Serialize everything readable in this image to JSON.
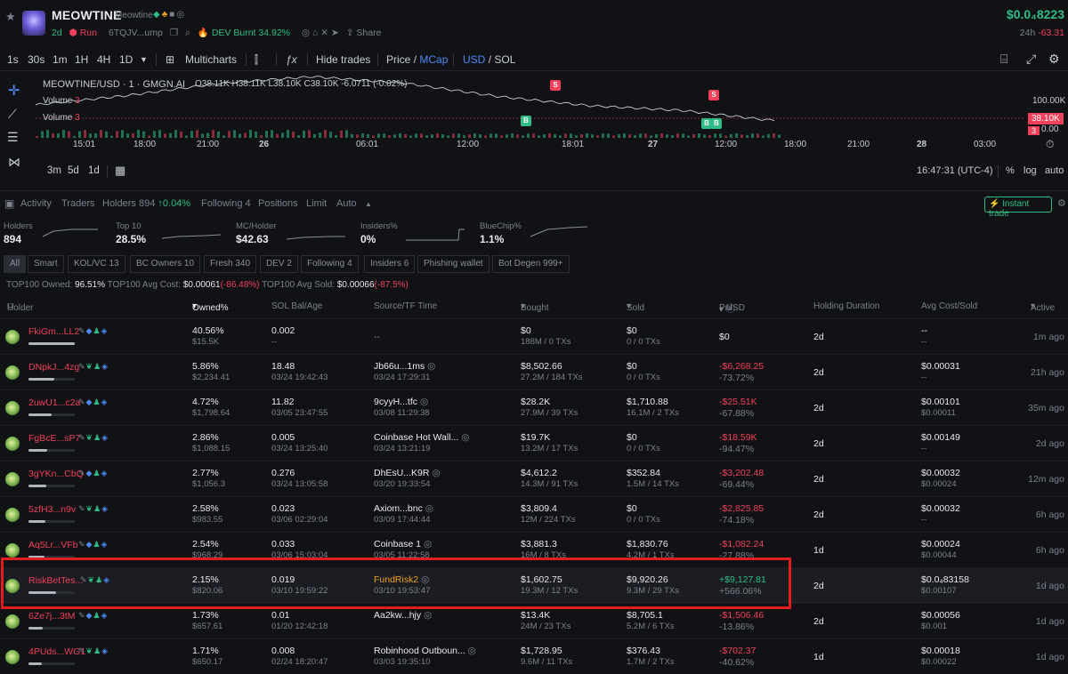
{
  "header": {
    "token_name": "MEOWTINE",
    "token_sub": "Meowtine",
    "age": "2d",
    "run_label": "Run",
    "address": "6TQJV...ump",
    "dev_burnt": "DEV Burnt 34.92%",
    "share": "Share",
    "price": "$0.0₄8223",
    "change_label": "24h",
    "change_value": "-63.31"
  },
  "timeframes": [
    "1s",
    "30s",
    "1m",
    "1H",
    "4H",
    "1D"
  ],
  "toolbar": {
    "multicharts": "Multicharts",
    "hide_trades": "Hide trades",
    "price": "Price",
    "mcap": "MCap",
    "usd": "USD",
    "sol": "SOL",
    "slash": "/"
  },
  "chart": {
    "legend_title": "MEOWTINE/USD · 1 · GMGN.AI",
    "ohlc": "O38.11K H38.11K L38.10K C38.10K -6.0711 (-0.02%)",
    "volume_label": "Volume",
    "volume_value": "3",
    "y_top": "100.00K",
    "y_price": "38.10K",
    "y_zero": "0.00",
    "y_vol": "3",
    "x_labels": [
      "15:01",
      "18:00",
      "21:00",
      "26",
      "06:01",
      "12:00",
      "18:01",
      "27",
      "12:00",
      "18:00",
      "21:00",
      "28",
      "03:00"
    ],
    "time": "16:47:31 (UTC-4)",
    "pct": "%",
    "log": "log",
    "auto": "auto",
    "ranges": [
      "3m",
      "5d",
      "1d"
    ]
  },
  "chart_data": {
    "type": "line",
    "title": "MEOWTINE/USD · 1 · GMGN.AI",
    "x": [
      "15:01",
      "18:00",
      "21:00",
      "26",
      "06:01",
      "12:00",
      "18:01",
      "27",
      "12:00"
    ],
    "series": [
      {
        "name": "MEOWTINE/USD",
        "values": [
          72000,
          92000,
          118000,
          132000,
          118000,
          90000,
          70000,
          60000,
          38100
        ]
      }
    ],
    "ylabel": "",
    "xlabel": ""
  },
  "tabs": {
    "activity": "Activity",
    "traders": "Traders",
    "holders": "Holders 894",
    "holders_change": "↑0.04%",
    "following": "Following 4",
    "positions": "Positions",
    "limit": "Limit",
    "auto": "Auto",
    "instant_trade": "Instant trade"
  },
  "stats": [
    {
      "label": "Holders",
      "value": "894"
    },
    {
      "label": "Top 10",
      "value": "28.5%"
    },
    {
      "label": "MC/Holder",
      "value": "$42.63"
    },
    {
      "label": "Insiders%",
      "value": "0%"
    },
    {
      "label": "BlueChip%",
      "value": "1.1%"
    }
  ],
  "filters": [
    "All",
    "Smart",
    "KOL/VC 13",
    "BC Owners 10",
    "Fresh 340",
    "DEV 2",
    "Following 4",
    "Insiders 6",
    "Phishing wallet",
    "Bot Degen 999+"
  ],
  "summary": {
    "owned_label": "TOP100 Owned:",
    "owned": "96.51%",
    "avg_cost_label": "TOP100 Avg Cost:",
    "avg_cost": "$0.00061",
    "avg_cost_pct": "(-86.48%)",
    "avg_sold_label": "TOP100 Avg Sold:",
    "avg_sold": "$0.00066",
    "avg_sold_pct": "(-87.5%)"
  },
  "columns": [
    "Holder",
    "Owned%",
    "SOL Bal/Age",
    "Source/TF Time",
    "Bought",
    "Sold",
    "Pnl",
    "USD",
    "Holding Duration",
    "Avg Cost/Sold",
    "Active"
  ],
  "rows": [
    {
      "holder": "FkiGm...LL2",
      "owned": "40.56%",
      "owned_usd": "$15.5K",
      "sol": "0.002",
      "age": "--",
      "source": "--",
      "source_time": "",
      "bought": "$0",
      "bought_sub": "188M / 0 TXs",
      "sold": "$0",
      "sold_sub": "0 / 0 TXs",
      "pnl": "$0",
      "pnl_pct": "",
      "dur": "2d",
      "avg_cost": "--",
      "avg_sold": "--",
      "active": "1m ago",
      "bar": 100
    },
    {
      "holder": "DNpkJ...4zg",
      "owned": "5.86%",
      "owned_usd": "$2,234.41",
      "sol": "18.48",
      "age": "03/24 19:42:43",
      "source": "Jb66u...1ms",
      "source_time": "03/24 17:29:31",
      "bought": "$8,502.66",
      "bought_sub": "27.2M / 184 TXs",
      "sold": "$0",
      "sold_sub": "0 / 0 TXs",
      "pnl": "-$6,268.25",
      "pnl_pct": "-73.72%",
      "dur": "2d",
      "avg_cost": "$0.00031",
      "avg_sold": "--",
      "active": "21h ago",
      "bar": 55
    },
    {
      "holder": "2uwU1...c2a",
      "owned": "4.72%",
      "owned_usd": "$1,798.64",
      "sol": "11.82",
      "age": "03/05 23:47:55",
      "source": "9cyyH...tfc",
      "source_time": "03/08 11:29:38",
      "bought": "$28.2K",
      "bought_sub": "27.9M / 39 TXs",
      "sold": "$1,710.88",
      "sold_sub": "16.1M / 2 TXs",
      "pnl": "-$25.51K",
      "pnl_pct": "-67.88%",
      "dur": "2d",
      "avg_cost": "$0.00101",
      "avg_sold": "$0.00011",
      "active": "35m ago",
      "bar": 50
    },
    {
      "holder": "FgBcE...sP7",
      "owned": "2.86%",
      "owned_usd": "$1,088.15",
      "sol": "0.005",
      "age": "03/24 13:25:40",
      "source": "Coinbase Hot Wall...",
      "source_time": "03/24 13:21:19",
      "bought": "$19.7K",
      "bought_sub": "13.2M / 17 TXs",
      "sold": "$0",
      "sold_sub": "0 / 0 TXs",
      "pnl": "-$18.59K",
      "pnl_pct": "-94.47%",
      "dur": "2d",
      "avg_cost": "$0.00149",
      "avg_sold": "--",
      "active": "2d ago",
      "bar": 40
    },
    {
      "holder": "3gYKn...CbQ",
      "owned": "2.77%",
      "owned_usd": "$1,056.3",
      "sol": "0.276",
      "age": "03/24 13:05:58",
      "source": "DhEsU...K9R",
      "source_time": "03/20 19:33:54",
      "bought": "$4,612.2",
      "bought_sub": "14.3M / 91 TXs",
      "sold": "$352.84",
      "sold_sub": "1.5M / 14 TXs",
      "pnl": "-$3,202.48",
      "pnl_pct": "-69.44%",
      "dur": "2d",
      "avg_cost": "$0.00032",
      "avg_sold": "$0.00024",
      "active": "12m ago",
      "bar": 38
    },
    {
      "holder": "5zfH3...n9v",
      "owned": "2.58%",
      "owned_usd": "$983.55",
      "sol": "0.023",
      "age": "03/06 02:29:04",
      "source": "Axiom...bnc",
      "source_time": "03/09 17:44:44",
      "bought": "$3,809.4",
      "bought_sub": "12M / 224 TXs",
      "sold": "$0",
      "sold_sub": "0 / 0 TXs",
      "pnl": "-$2,825.85",
      "pnl_pct": "-74.18%",
      "dur": "2d",
      "avg_cost": "$0.00032",
      "avg_sold": "--",
      "active": "6h ago",
      "bar": 36
    },
    {
      "holder": "Aq5Lr...VFb",
      "owned": "2.54%",
      "owned_usd": "$968.29",
      "sol": "0.033",
      "age": "03/06 15:03:04",
      "source": "Coinbase 1",
      "source_time": "03/05 11:22:58",
      "bought": "$3,881.3",
      "bought_sub": "16M / 8 TXs",
      "sold": "$1,830.76",
      "sold_sub": "4.2M / 1 TXs",
      "pnl": "-$1,082.24",
      "pnl_pct": "-27.88%",
      "dur": "1d",
      "avg_cost": "$0.00024",
      "avg_sold": "$0.00044",
      "active": "6h ago",
      "bar": 35
    },
    {
      "holder": "RiskBetTes...",
      "owned": "2.15%",
      "owned_usd": "$820.06",
      "sol": "0.019",
      "age": "03/10 19:59:22",
      "source": "FundRisk2",
      "source_time": "03/10 19:53:47",
      "bought": "$1,602.75",
      "bought_sub": "19.3M / 12 TXs",
      "sold": "$9,920.26",
      "sold_sub": "9.3M / 29 TXs",
      "pnl": "+$9,127.81",
      "pnl_pct": "+566.06%",
      "dur": "2d",
      "avg_cost": "$0.0₄83158",
      "avg_sold": "$0.00107",
      "active": "1d ago",
      "bar": 60
    },
    {
      "holder": "6Ze7j...3tM",
      "owned": "1.73%",
      "owned_usd": "$657.61",
      "sol": "0.01",
      "age": "01/20 12:42:18",
      "source": "Aa2kw...hjy",
      "source_time": "",
      "bought": "$13.4K",
      "bought_sub": "24M / 23 TXs",
      "sold": "$8,705.1",
      "sold_sub": "5.2M / 6 TXs",
      "pnl": "-$1,506.46",
      "pnl_pct": "-13.86%",
      "dur": "2d",
      "avg_cost": "$0.00056",
      "avg_sold": "$0.001",
      "active": "1d ago",
      "bar": 30
    },
    {
      "holder": "4PUds...WG1",
      "owned": "1.71%",
      "owned_usd": "$650.17",
      "sol": "0.008",
      "age": "02/24 18:20:47",
      "source": "Robinhood Outboun...",
      "source_time": "03/03 19:35:10",
      "bought": "$1,728.95",
      "bought_sub": "9.6M / 11 TXs",
      "sold": "$376.43",
      "sold_sub": "1.7M / 2 TXs",
      "pnl": "-$702.37",
      "pnl_pct": "-40.62%",
      "dur": "1d",
      "avg_cost": "$0.00018",
      "avg_sold": "$0.00022",
      "active": "1d ago",
      "bar": 28
    }
  ],
  "colors": {
    "green": "#2ebd85",
    "red": "#f0405a",
    "blue": "#4d8cf5",
    "highlight": "#e01e1e",
    "orange": "#f0a020"
  }
}
